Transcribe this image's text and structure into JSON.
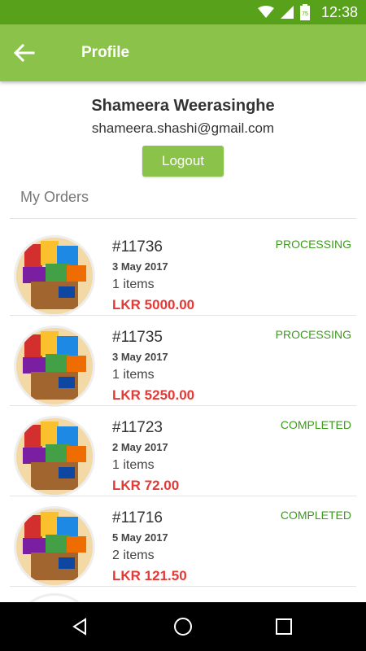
{
  "status_bar": {
    "time": "12:38",
    "battery_level": "75"
  },
  "app_bar": {
    "title": "Profile",
    "back_icon": "arrow-left-icon"
  },
  "profile": {
    "name": "Shameera Weerasinghe",
    "email": "shameera.shashi@gmail.com",
    "logout_label": "Logout"
  },
  "orders_section": {
    "title": "My Orders",
    "orders": [
      {
        "id": "#11736",
        "date": "3 May 2017",
        "items": "1 items",
        "total": "LKR 5000.00",
        "status": "PROCESSING"
      },
      {
        "id": "#11735",
        "date": "3 May 2017",
        "items": "1 items",
        "total": "LKR 5250.00",
        "status": "PROCESSING"
      },
      {
        "id": "#11723",
        "date": "2 May 2017",
        "items": "1 items",
        "total": "LKR 72.00",
        "status": "COMPLETED"
      },
      {
        "id": "#11716",
        "date": "5 May 2017",
        "items": "2 items",
        "total": "LKR 121.50",
        "status": "COMPLETED"
      }
    ]
  },
  "colors": {
    "status_bar": "#58a21b",
    "app_bar": "#8bc34a",
    "price": "#e53935",
    "status_text": "#3e9a1e"
  }
}
